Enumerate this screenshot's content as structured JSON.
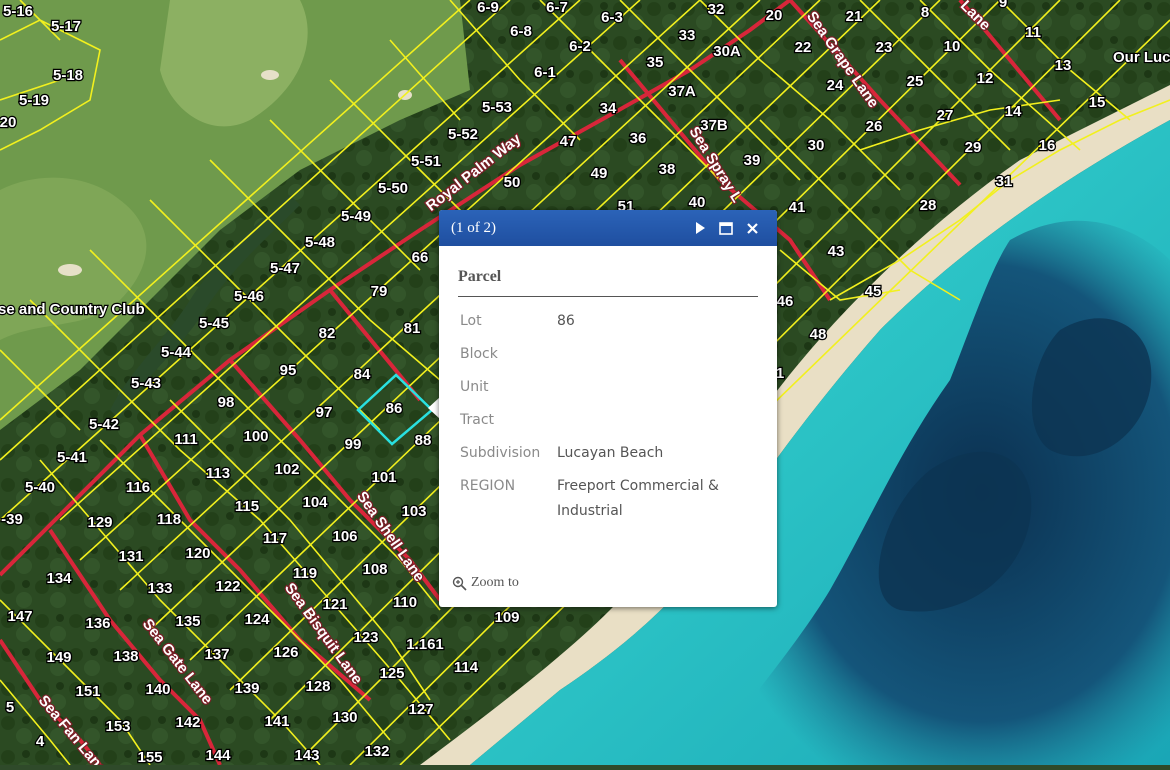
{
  "map": {
    "place_labels": [
      "se and Country Club",
      "Our Luc"
    ],
    "road_labels": [
      "Royal Palm Way",
      "Sea Spray L",
      "Sea Grape Lane",
      "Lane",
      "Sea Shell Lane",
      "Sea Bisquit Lane",
      "Sea Gate Lane",
      "Sea Fan Lane"
    ],
    "parcel_labels": [
      "5-16",
      "5-17",
      "5-18",
      "5-19",
      "20",
      "6-9",
      "6-7",
      "6-8",
      "6-3",
      "6-2",
      "6-1",
      "32",
      "33",
      "30A",
      "35",
      "37A",
      "5-53",
      "34",
      "37B",
      "47",
      "36",
      "5-52",
      "5-51",
      "50",
      "49",
      "38",
      "5-50",
      "39",
      "5-49",
      "51",
      "40",
      "5-48",
      "66",
      "5-47",
      "79",
      "5-46",
      "82",
      "81",
      "5-45",
      "5-44",
      "95",
      "84",
      "5-43",
      "98",
      "97",
      "86",
      "100",
      "111",
      "99",
      "88",
      "5-42",
      "5-41",
      "113",
      "102",
      "101",
      "116",
      "115",
      "104",
      "103",
      "5-40",
      "-39",
      "129",
      "118",
      "117",
      "106",
      "131",
      "120",
      "108",
      "119",
      "134",
      "133",
      "122",
      "110",
      "121",
      "147",
      "136",
      "135",
      "124",
      "123",
      "1.161",
      "109",
      "149",
      "138",
      "137",
      "126",
      "114",
      "151",
      "140",
      "139",
      "128",
      "125",
      "5",
      "153",
      "142",
      "141",
      "130",
      "127",
      "4",
      "155",
      "144",
      "143",
      "132",
      "20",
      "21",
      "8",
      "9",
      "22",
      "23",
      "10",
      "11",
      "24",
      "25",
      "12",
      "13",
      "15",
      "30",
      "26",
      "27",
      "14",
      "29",
      "16",
      "31",
      "41",
      "28",
      "43",
      "46",
      "45",
      "48",
      "1"
    ],
    "selected_parcel": "86"
  },
  "popup": {
    "count": "(1 of 2)",
    "icons": {
      "next": "next-arrow-icon",
      "maximize": "maximize-icon",
      "close": "close-icon",
      "zoom": "zoom-in-icon"
    },
    "title": "Parcel",
    "fields": [
      {
        "key": "Lot",
        "value": "86"
      },
      {
        "key": "Block",
        "value": ""
      },
      {
        "key": "Unit",
        "value": ""
      },
      {
        "key": "Tract",
        "value": ""
      },
      {
        "key": "Subdivision",
        "value": "Lucayan Beach"
      },
      {
        "key": "REGION",
        "value": "Freeport Commercial & Industrial"
      }
    ],
    "zoom_label": "Zoom to"
  },
  "colors": {
    "parcel_line": "#f2f01e",
    "road_line": "#d8263a",
    "selected_outline": "#29e0e0",
    "popup_header": "#2156a8",
    "ocean_shallow": "#2fc8c4",
    "ocean_deep": "#0d3d5c"
  }
}
